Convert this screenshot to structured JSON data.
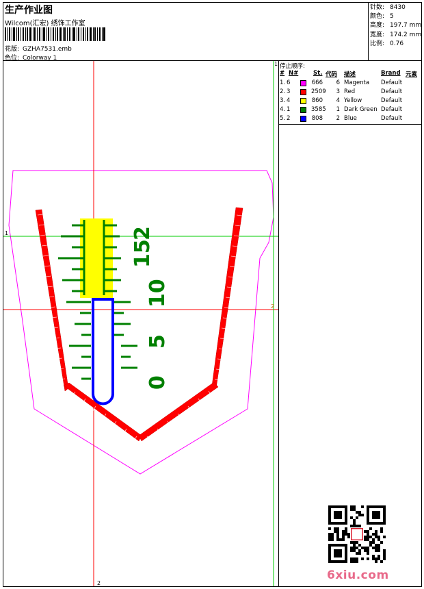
{
  "header": {
    "title": "生产作业图",
    "subtitle": "Wilcom(汇宏) 绣饰工作室",
    "design_label": "花版:",
    "design_value": "GZHA7531.emb",
    "colorway_label": "色位:",
    "colorway_value": "Colorway 1"
  },
  "stats": [
    {
      "label": "针数:",
      "value": "8430"
    },
    {
      "label": "颜色:",
      "value": "5"
    },
    {
      "label": "高度:",
      "value": "197.7 mm"
    },
    {
      "label": "宽度:",
      "value": "174.2 mm"
    },
    {
      "label": "比例:",
      "value": "0.76"
    }
  ],
  "stop_sequence": {
    "title": "停止顺序:",
    "columns": {
      "num": "#",
      "n": "N#",
      "st": "St.",
      "code": "代码",
      "desc": "描述",
      "brand": "Brand",
      "elem": "元素"
    },
    "rows": [
      {
        "num": "1.",
        "n": "6",
        "color": "#ff00ff",
        "st": "666",
        "code": "6",
        "desc": "Magenta",
        "brand": "Default"
      },
      {
        "num": "2.",
        "n": "3",
        "color": "#ff0000",
        "st": "2509",
        "code": "3",
        "desc": "Red",
        "brand": "Default"
      },
      {
        "num": "3.",
        "n": "4",
        "color": "#ffff00",
        "st": "860",
        "code": "4",
        "desc": "Yellow",
        "brand": "Default"
      },
      {
        "num": "4.",
        "n": "1",
        "color": "#008000",
        "st": "3585",
        "code": "1",
        "desc": "Dark Green",
        "brand": "Default"
      },
      {
        "num": "5.",
        "n": "2",
        "color": "#0000ff",
        "st": "808",
        "code": "2",
        "desc": "Blue",
        "brand": "Default"
      }
    ]
  },
  "design": {
    "ruler_digits": [
      "0",
      "5",
      "10",
      "15",
      "2"
    ],
    "guide_labels": {
      "v_top": "1",
      "v_bottom": "2",
      "h_left": "1",
      "h_right": "2"
    }
  },
  "watermark": "6xiu.com"
}
